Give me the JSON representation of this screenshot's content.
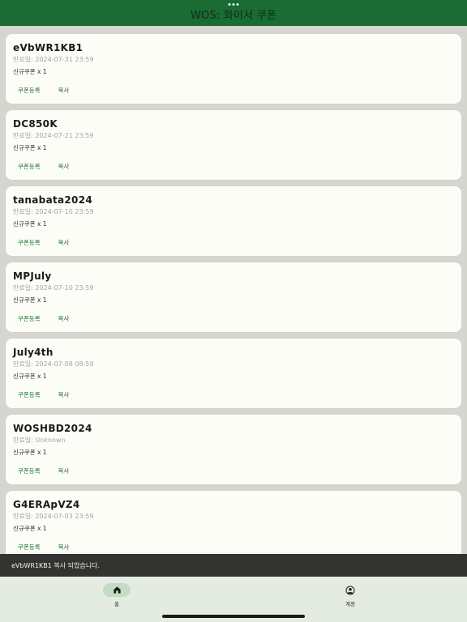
{
  "header": {
    "title": "WOS: 화이서 쿠폰"
  },
  "coupons": [
    {
      "code": "eVbWR1KB1",
      "expiry": "만료일: 2024-07-31 23:59",
      "reward": "신규쿠폰 x 1",
      "register_label": "쿠폰등록",
      "copy_label": "복사"
    },
    {
      "code": "DC850K",
      "expiry": "만료일: 2024-07-21 23:59",
      "reward": "신규쿠폰 x 1",
      "register_label": "쿠폰등록",
      "copy_label": "복사"
    },
    {
      "code": "tanabata2024",
      "expiry": "만료일: 2024-07-10 23:59",
      "reward": "신규쿠폰 x 1",
      "register_label": "쿠폰등록",
      "copy_label": "복사"
    },
    {
      "code": "MPJuly",
      "expiry": "만료일: 2024-07-10 23:59",
      "reward": "신규쿠폰 x 1",
      "register_label": "쿠폰등록",
      "copy_label": "복사"
    },
    {
      "code": "July4th",
      "expiry": "만료일: 2024-07-08 08:59",
      "reward": "신규쿠폰 x 1",
      "register_label": "쿠폰등록",
      "copy_label": "복사"
    },
    {
      "code": "WOSHBD2024",
      "expiry": "만료일: Unknown",
      "reward": "신규쿠폰 x 1",
      "register_label": "쿠폰등록",
      "copy_label": "복사"
    },
    {
      "code": "G4ERApVZ4",
      "expiry": "만료일: 2024-07-03 23:59",
      "reward": "신규쿠폰 x 1",
      "register_label": "쿠폰등록",
      "copy_label": "복사"
    }
  ],
  "snackbar": {
    "message": "eVbWR1KB1 복사 되었습니다."
  },
  "nav": {
    "home_label": "홈",
    "home_icon": "home-icon",
    "account_label": "계정",
    "account_icon": "account-circle-icon"
  },
  "colors": {
    "header": "#1b6b34",
    "accent": "#2d6b3c",
    "background": "#d6d6d0",
    "card": "#fdfdf8",
    "snackbar": "#333431",
    "nav": "#e4ece2"
  }
}
